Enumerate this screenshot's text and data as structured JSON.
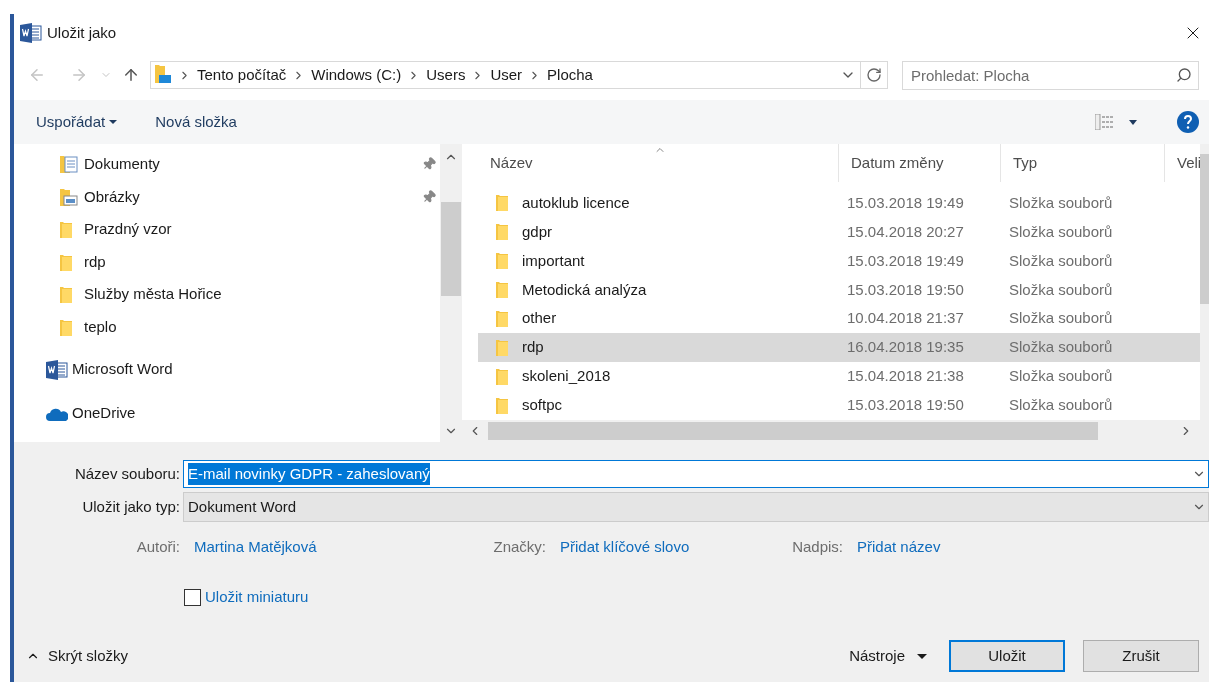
{
  "window": {
    "title": "Uložit jako"
  },
  "address": {
    "crumbs": [
      "Tento počítač",
      "Windows (C:)",
      "Users",
      "User",
      "Plocha"
    ]
  },
  "search": {
    "placeholder": "Prohledat: Plocha"
  },
  "toolbar": {
    "organize": "Uspořádat",
    "new_folder": "Nová složka"
  },
  "nav": {
    "items": [
      {
        "children": [
          {
            "label": "Dokumenty",
            "kind": "documents",
            "pinned": true
          },
          {
            "label": "Obrázky",
            "kind": "pictures",
            "pinned": true
          },
          {
            "label": "Prazdný vzor",
            "kind": "folder",
            "pinned": false
          },
          {
            "label": "rdp",
            "kind": "folder",
            "pinned": false
          },
          {
            "label": "Služby města Hořice",
            "kind": "folder",
            "pinned": false
          },
          {
            "label": "teplo",
            "kind": "folder",
            "pinned": false
          }
        ]
      },
      {
        "label": "Microsoft Word",
        "kind": "word"
      },
      {
        "label": "OneDrive",
        "kind": "onedrive"
      }
    ]
  },
  "files": {
    "columns": [
      "Název",
      "Datum změny",
      "Typ",
      "Veli"
    ],
    "rows": [
      {
        "name": "autoklub licence",
        "date": "15.03.2018 19:49",
        "type": "Složka souborů",
        "selected": false
      },
      {
        "name": "gdpr",
        "date": "15.04.2018 20:27",
        "type": "Složka souborů",
        "selected": false
      },
      {
        "name": "important",
        "date": "15.03.2018 19:49",
        "type": "Složka souborů",
        "selected": false
      },
      {
        "name": "Metodická analýza",
        "date": "15.03.2018 19:50",
        "type": "Složka souborů",
        "selected": false
      },
      {
        "name": "other",
        "date": "10.04.2018 21:37",
        "type": "Složka souborů",
        "selected": false
      },
      {
        "name": "rdp",
        "date": "16.04.2018 19:35",
        "type": "Složka souborů",
        "selected": true
      },
      {
        "name": "skoleni_2018",
        "date": "15.04.2018 21:38",
        "type": "Složka souborů",
        "selected": false
      },
      {
        "name": "softpc",
        "date": "15.03.2018 19:50",
        "type": "Složka souborů",
        "selected": false
      }
    ]
  },
  "form": {
    "filename_label": "Název souboru:",
    "filename": "E-mail novinky GDPR - zaheslovaný",
    "type_label": "Uložit jako typ:",
    "type": "Dokument Word",
    "meta": [
      {
        "label": "Autoři:",
        "value": "Martina Matějková"
      },
      {
        "label": "Značky:",
        "value": "Přidat klíčové slovo"
      },
      {
        "label": "Nadpis:",
        "value": "Přidat název"
      }
    ],
    "thumbnail": {
      "label": "Uložit miniaturu",
      "checked": false
    }
  },
  "footer": {
    "hide_folders": "Skrýt složky",
    "tools": "Nástroje",
    "save": "Uložit",
    "cancel": "Zrušit"
  }
}
